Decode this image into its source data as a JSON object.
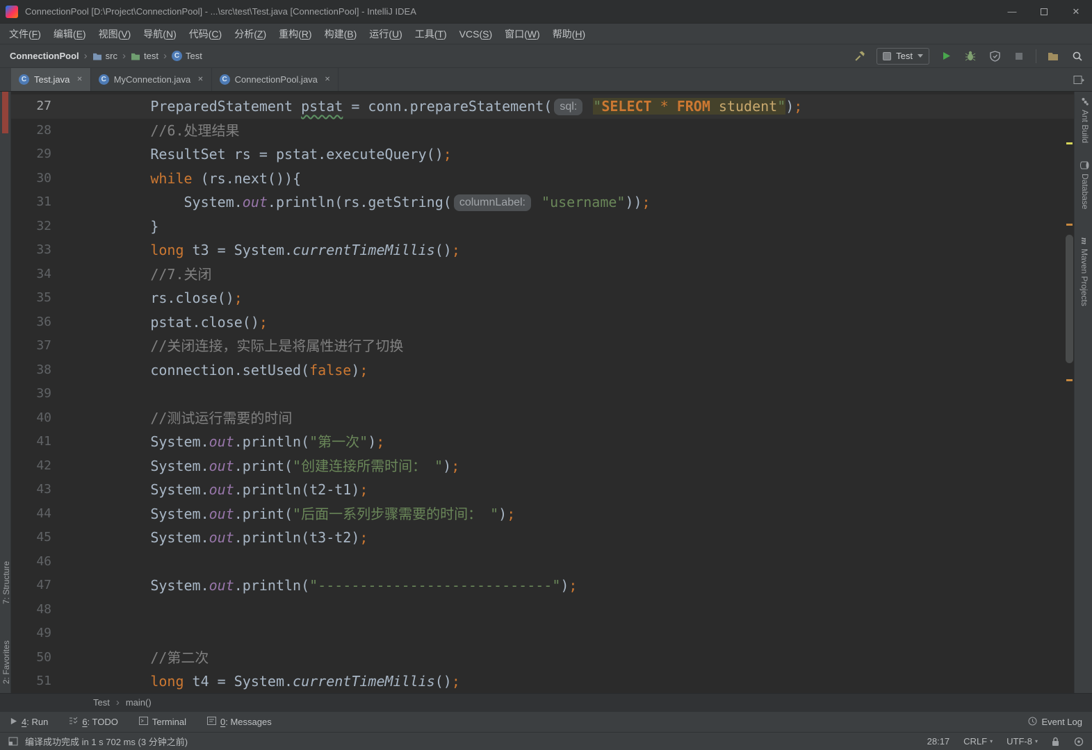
{
  "window": {
    "title": "ConnectionPool [D:\\Project\\ConnectionPool] - ...\\src\\test\\Test.java [ConnectionPool] - IntelliJ IDEA"
  },
  "menu": [
    "文件(F)",
    "编辑(E)",
    "视图(V)",
    "导航(N)",
    "代码(C)",
    "分析(Z)",
    "重构(R)",
    "构建(B)",
    "运行(U)",
    "工具(T)",
    "VCS(S)",
    "窗口(W)",
    "帮助(H)"
  ],
  "navbar": {
    "crumbs": [
      {
        "label": "ConnectionPool",
        "icon": "project"
      },
      {
        "label": "src",
        "icon": "folder",
        "color": "#7a94b5"
      },
      {
        "label": "test",
        "icon": "folder",
        "color": "#6f9e70"
      },
      {
        "label": "Test",
        "icon": "class"
      }
    ]
  },
  "toolbar": {
    "run_config": "Test"
  },
  "tabs": [
    {
      "label": "Test.java",
      "active": true
    },
    {
      "label": "MyConnection.java",
      "active": false
    },
    {
      "label": "ConnectionPool.java",
      "active": false
    }
  ],
  "left_stripe": [
    "7: Structure",
    "2: Favorites"
  ],
  "right_stripe": [
    {
      "label": "Ant Build",
      "icon": "ant"
    },
    {
      "label": "Database",
      "icon": "database"
    },
    {
      "label": "Maven Projects",
      "icon": "maven"
    }
  ],
  "editor": {
    "lines": [
      {
        "num": 27,
        "current": true,
        "segs": [
          [
            "plain",
            "        PreparedStatement "
          ],
          [
            "decl",
            "pstat"
          ],
          [
            "plain",
            " = conn.prepareStatement("
          ],
          [
            "inlay",
            "sql:"
          ],
          [
            "plain",
            " "
          ],
          [
            "inj-str",
            "\""
          ],
          [
            "inj-kw",
            "SELECT"
          ],
          [
            "inj-pl",
            " * "
          ],
          [
            "inj-kw",
            "FROM"
          ],
          [
            "inj-id",
            " student"
          ],
          [
            "inj-str",
            "\""
          ],
          [
            "plain",
            ")"
          ],
          [
            "semi",
            ";"
          ]
        ]
      },
      {
        "num": 28,
        "segs": [
          [
            "cmt",
            "        //6.处理结果"
          ]
        ]
      },
      {
        "num": 29,
        "segs": [
          [
            "plain",
            "        ResultSet rs = pstat.executeQuery()"
          ],
          [
            "semi",
            ";"
          ]
        ]
      },
      {
        "num": 30,
        "segs": [
          [
            "plain",
            "        "
          ],
          [
            "kw",
            "while"
          ],
          [
            "plain",
            " (rs.next()){"
          ]
        ]
      },
      {
        "num": 31,
        "segs": [
          [
            "plain",
            "            System."
          ],
          [
            "field",
            "out"
          ],
          [
            "plain",
            ".println(rs.getString("
          ],
          [
            "inlay",
            "columnLabel:"
          ],
          [
            "plain",
            " "
          ],
          [
            "str",
            "\"username\""
          ],
          [
            "plain",
            "))"
          ],
          [
            "semi",
            ";"
          ]
        ]
      },
      {
        "num": 32,
        "segs": [
          [
            "plain",
            "        }"
          ]
        ]
      },
      {
        "num": 33,
        "segs": [
          [
            "plain",
            "        "
          ],
          [
            "kw",
            "long"
          ],
          [
            "plain",
            " t3 = System."
          ],
          [
            "staticm",
            "currentTimeMillis"
          ],
          [
            "plain",
            "()"
          ],
          [
            "semi",
            ";"
          ]
        ]
      },
      {
        "num": 34,
        "segs": [
          [
            "cmt",
            "        //7.关闭"
          ]
        ]
      },
      {
        "num": 35,
        "segs": [
          [
            "plain",
            "        rs.close()"
          ],
          [
            "semi",
            ";"
          ]
        ]
      },
      {
        "num": 36,
        "segs": [
          [
            "plain",
            "        pstat.close()"
          ],
          [
            "semi",
            ";"
          ]
        ]
      },
      {
        "num": 37,
        "segs": [
          [
            "cmt",
            "        //关闭连接，实际上是将属性进行了切换"
          ]
        ]
      },
      {
        "num": 38,
        "segs": [
          [
            "plain",
            "        connection.setUsed("
          ],
          [
            "kw",
            "false"
          ],
          [
            "plain",
            ")"
          ],
          [
            "semi",
            ";"
          ]
        ]
      },
      {
        "num": 39,
        "segs": []
      },
      {
        "num": 40,
        "segs": [
          [
            "cmt",
            "        //测试运行需要的时间"
          ]
        ]
      },
      {
        "num": 41,
        "segs": [
          [
            "plain",
            "        System."
          ],
          [
            "field",
            "out"
          ],
          [
            "plain",
            ".println("
          ],
          [
            "str",
            "\"第一次\""
          ],
          [
            "plain",
            ")"
          ],
          [
            "semi",
            ";"
          ]
        ]
      },
      {
        "num": 42,
        "segs": [
          [
            "plain",
            "        System."
          ],
          [
            "field",
            "out"
          ],
          [
            "plain",
            ".print("
          ],
          [
            "str",
            "\"创建连接所需时间： \""
          ],
          [
            "plain",
            ")"
          ],
          [
            "semi",
            ";"
          ]
        ]
      },
      {
        "num": 43,
        "segs": [
          [
            "plain",
            "        System."
          ],
          [
            "field",
            "out"
          ],
          [
            "plain",
            ".println(t2-t1)"
          ],
          [
            "semi",
            ";"
          ]
        ]
      },
      {
        "num": 44,
        "segs": [
          [
            "plain",
            "        System."
          ],
          [
            "field",
            "out"
          ],
          [
            "plain",
            ".print("
          ],
          [
            "str",
            "\"后面一系列步骤需要的时间： \""
          ],
          [
            "plain",
            ")"
          ],
          [
            "semi",
            ";"
          ]
        ]
      },
      {
        "num": 45,
        "segs": [
          [
            "plain",
            "        System."
          ],
          [
            "field",
            "out"
          ],
          [
            "plain",
            ".println(t3-t2)"
          ],
          [
            "semi",
            ";"
          ]
        ]
      },
      {
        "num": 46,
        "segs": []
      },
      {
        "num": 47,
        "segs": [
          [
            "plain",
            "        System."
          ],
          [
            "field",
            "out"
          ],
          [
            "plain",
            ".println("
          ],
          [
            "str",
            "\"----------------------------\""
          ],
          [
            "plain",
            ")"
          ],
          [
            "semi",
            ";"
          ]
        ]
      },
      {
        "num": 48,
        "segs": []
      },
      {
        "num": 49,
        "segs": []
      },
      {
        "num": 50,
        "segs": [
          [
            "cmt",
            "        //第二次"
          ]
        ]
      },
      {
        "num": 51,
        "segs": [
          [
            "plain",
            "        "
          ],
          [
            "kw",
            "long"
          ],
          [
            "plain",
            " t4 = System."
          ],
          [
            "staticm",
            "currentTimeMillis"
          ],
          [
            "plain",
            "()"
          ],
          [
            "semi",
            ";"
          ]
        ]
      }
    ]
  },
  "breadcrumbs_bottom": [
    "Test",
    "main()"
  ],
  "bottom_bar": {
    "left": [
      {
        "label": "4: Run",
        "mn": "4",
        "icon": "run"
      },
      {
        "label": "6: TODO",
        "mn": "6",
        "icon": "todo"
      },
      {
        "label": "Terminal",
        "icon": "terminal"
      },
      {
        "label": "0: Messages",
        "mn": "0",
        "icon": "messages"
      }
    ],
    "right": [
      {
        "label": "Event Log",
        "icon": "eventlog"
      }
    ]
  },
  "status_bar": {
    "message": "编译成功完成 in 1 s 702 ms (3 分钟之前)",
    "caret": "28:17",
    "line_ending": "CRLF",
    "encoding": "UTF-8"
  },
  "icons": {
    "class_letter": "C",
    "close": "✕",
    "chevron": "›",
    "minimize": "—",
    "window_close": "✕",
    "maven_letter": "m"
  }
}
